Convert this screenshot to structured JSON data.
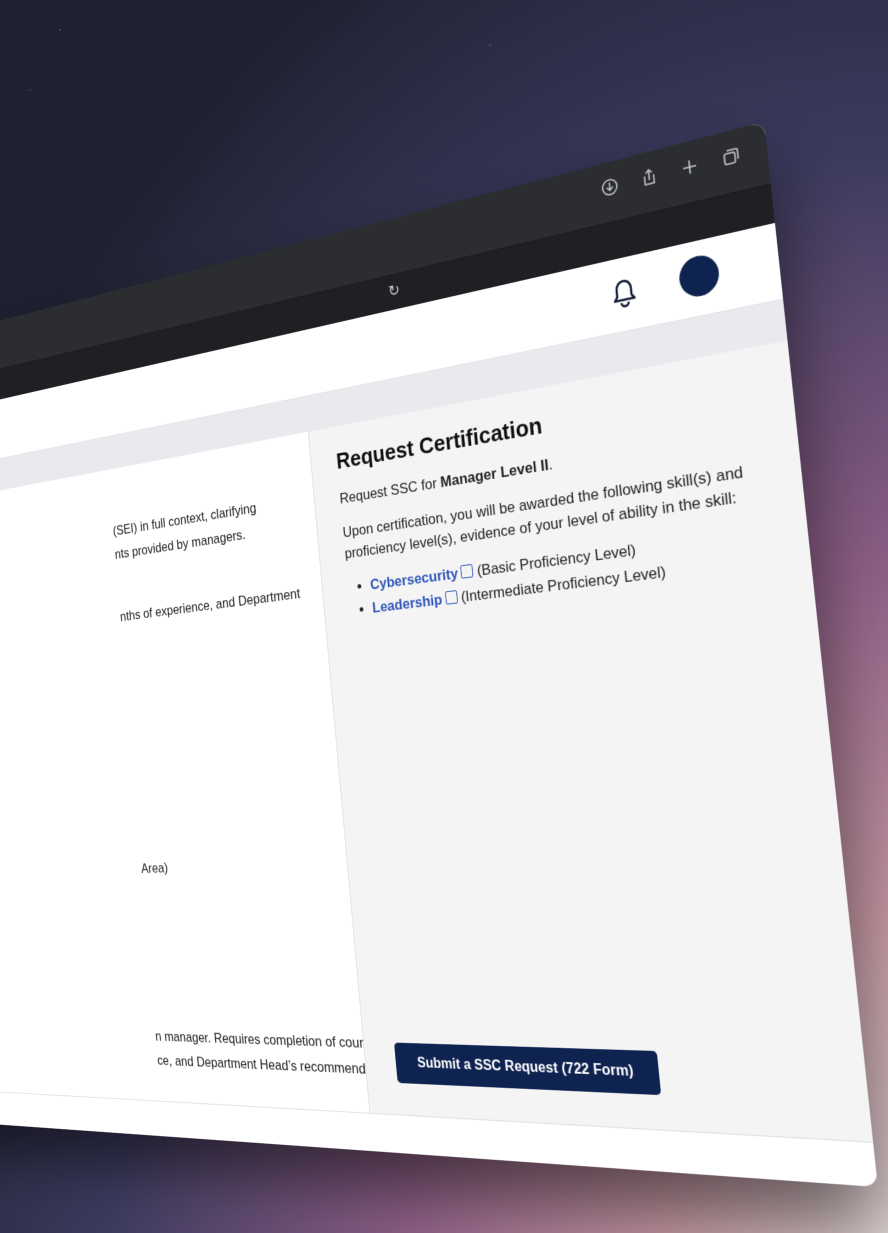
{
  "browser": {
    "icons": [
      "download-icon",
      "share-icon",
      "new-tab-icon",
      "tabs-icon"
    ],
    "reload_icon": "reload-icon"
  },
  "header": {
    "bell_icon": "bell-icon",
    "avatar": "avatar"
  },
  "main": {
    "lines": [
      "(SEI) in full context, clarifying",
      "nts provided by managers.",
      "nths of experience, and Department",
      "Area)",
      "n manager. Requires completion of course",
      "ce, and Department Head’s recommendation. It"
    ]
  },
  "sidebar": {
    "title": "Request Certification",
    "request_prefix": "Request SSC for ",
    "request_bold": "Manager Level II",
    "request_suffix": ".",
    "intro": "Upon certification, you will be awarded the following skill(s) and proficiency level(s), evidence of your level of ability in the skill:",
    "skills": [
      {
        "name": "Cybersecurity",
        "level": "(Basic Proficiency Level)"
      },
      {
        "name": "Leadership",
        "level": "(Intermediate Proficiency Level)"
      }
    ],
    "submit_label": "Submit a SSC Request (722 Form)"
  }
}
